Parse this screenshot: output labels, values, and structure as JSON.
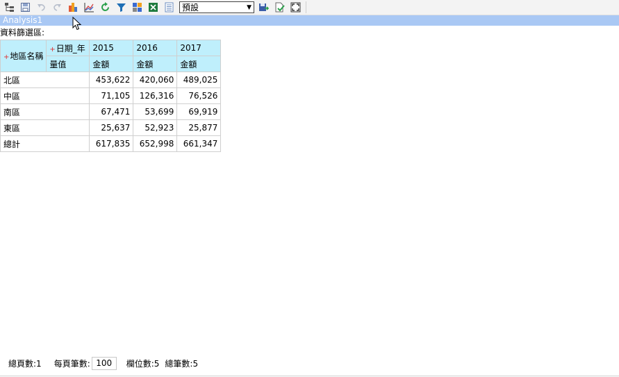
{
  "toolbar": {
    "buttons": [
      {
        "icon": "tree-layout-icon"
      },
      {
        "icon": "save-form-icon"
      },
      {
        "icon": "undo-icon"
      },
      {
        "icon": "redo-icon"
      },
      {
        "icon": "bar-chart-icon"
      },
      {
        "icon": "line-chart-icon"
      },
      {
        "icon": "refresh-icon"
      },
      {
        "icon": "filter-icon"
      },
      {
        "icon": "color-grid-icon"
      },
      {
        "icon": "excel-export-icon"
      },
      {
        "icon": "document-list-icon"
      }
    ],
    "view_select": {
      "selected": "預設"
    },
    "right_buttons": [
      {
        "icon": "save-as-icon"
      },
      {
        "icon": "check-document-icon"
      },
      {
        "icon": "fullscreen-icon"
      }
    ]
  },
  "title": "Analysis1",
  "filter_label": "資料篩選區:",
  "pivot": {
    "row_field": "地區名稱",
    "col_field": "日期_年",
    "measure_label": "量值",
    "years": [
      "2015",
      "2016",
      "2017"
    ],
    "measure_name": "金額",
    "rows": [
      {
        "label": "北區",
        "values": [
          "453,622",
          "420,060",
          "489,025"
        ]
      },
      {
        "label": "中區",
        "values": [
          "71,105",
          "126,316",
          "76,526"
        ]
      },
      {
        "label": "南區",
        "values": [
          "67,471",
          "53,699",
          "69,919"
        ]
      },
      {
        "label": "東區",
        "values": [
          "25,637",
          "52,923",
          "25,877"
        ]
      },
      {
        "label": "總計",
        "values": [
          "617,835",
          "652,998",
          "661,347"
        ]
      }
    ]
  },
  "footer": {
    "total_pages": "總頁數:1",
    "per_page_label": "每頁筆數:",
    "per_page_value": "100",
    "column_count": "欄位數:5",
    "total_records": "總筆數:5"
  },
  "colors": {
    "title_bar": "#a9c8f4",
    "header_cell": "#bfeffc",
    "plus": "#e03030"
  }
}
